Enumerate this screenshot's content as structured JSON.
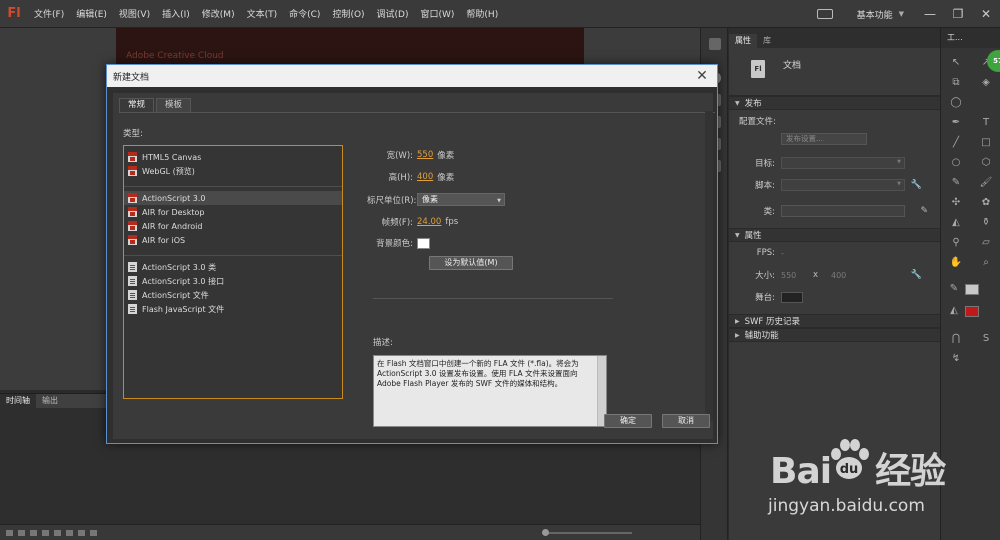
{
  "app": {
    "logo": "Fl",
    "menu": [
      "文件(F)",
      "编辑(E)",
      "视图(V)",
      "插入(I)",
      "修改(M)",
      "文本(T)",
      "命令(C)",
      "控制(O)",
      "调试(D)",
      "窗口(W)",
      "帮助(H)"
    ],
    "workspace": "基本功能",
    "window_controls": [
      "—",
      "❐",
      "✕"
    ]
  },
  "stage": {
    "banner_text": "Adobe Creative Cloud"
  },
  "timeline": {
    "tabs": [
      "时间轴",
      "输出"
    ]
  },
  "properties": {
    "tabs": [
      "属性",
      "库"
    ],
    "doc_icon": "Fl",
    "doc_label": "文档",
    "publish_section": "发布",
    "profile_label": "配置文件:",
    "publish_settings_btn": "发布设置...",
    "target_label": "目标:",
    "script_label": "脚本:",
    "class_label": "类:",
    "props_section": "属性",
    "fps_label": "FPS:",
    "fps_value": "-",
    "size_label": "大小:",
    "size_w": "550",
    "size_x": "x",
    "size_h": "400",
    "stage_label": "舞台:",
    "swf_history": "SWF 历史记录",
    "accessibility": "辅助功能"
  },
  "tools": {
    "header": "工...",
    "badge": "57"
  },
  "dialog": {
    "title": "新建文档",
    "close": "✕",
    "tabs": [
      "常规",
      "模板"
    ],
    "type_label": "类型:",
    "groups": [
      [
        {
          "label": "HTML5 Canvas",
          "icon": "red"
        },
        {
          "label": "WebGL (预览)",
          "icon": "red"
        }
      ],
      [
        {
          "label": "ActionScript 3.0",
          "icon": "red",
          "selected": true
        },
        {
          "label": "AIR for Desktop",
          "icon": "red"
        },
        {
          "label": "AIR for Android",
          "icon": "red"
        },
        {
          "label": "AIR for iOS",
          "icon": "red"
        }
      ],
      [
        {
          "label": "ActionScript 3.0 类",
          "icon": "doc"
        },
        {
          "label": "ActionScript 3.0 接口",
          "icon": "doc"
        },
        {
          "label": "ActionScript 文件",
          "icon": "doc"
        },
        {
          "label": "Flash JavaScript 文件",
          "icon": "doc"
        }
      ]
    ],
    "width_label": "宽(W):",
    "width_value": "550",
    "height_label": "高(H):",
    "height_value": "400",
    "pixel_unit": "像素",
    "ruler_label": "标尺单位(R):",
    "ruler_value": "像素",
    "fps_label": "帧频(F):",
    "fps_value": "24.00",
    "fps_unit": "fps",
    "bg_label": "背景颜色:",
    "bg_color": "#ffffff",
    "default_btn": "设为默认值(M)",
    "desc_label": "描述:",
    "desc_text": "在 Flash 文档窗口中创建一个新的 FLA 文件 (*.fla)。将会为 ActionScript 3.0 设置发布设置。使用 FLA 文件来设置面向 Adobe Flash Player 发布的 SWF 文件的媒体和结构。",
    "ok_btn": "确定",
    "cancel_btn": "取消"
  },
  "watermark": {
    "brand": "Bai",
    "brand2": "经验",
    "url": "jingyan.baidu.com"
  },
  "colors": {
    "accent_orange": "#c88a1a",
    "dialog_border": "#5a8fd0",
    "logo_red": "#d24a30"
  }
}
